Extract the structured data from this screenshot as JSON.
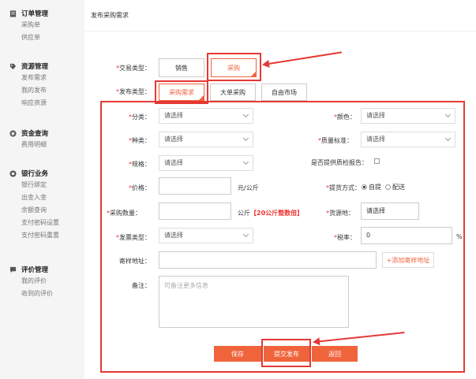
{
  "sidebar": {
    "groups": [
      {
        "title": "订单管理",
        "items": [
          "采购单",
          "供应单"
        ]
      },
      {
        "title": "资源管理",
        "items": [
          "发布需求",
          "我的发布",
          "响应资源"
        ]
      },
      {
        "title": "资金查询",
        "items": [
          "费用明细"
        ]
      },
      {
        "title": "银行业务",
        "items": [
          "银行绑定",
          "出金入金",
          "余额查询",
          "支付密码设置",
          "支付密码重置"
        ]
      },
      {
        "title": "评价管理",
        "items": [
          "我的评价",
          "收到的评价"
        ]
      }
    ]
  },
  "page": {
    "title": "发布采购需求"
  },
  "trade_type": {
    "label": "交易类型：",
    "options": [
      "销售",
      "采购"
    ],
    "selected": "采购"
  },
  "publish_type": {
    "label": "发布类型：",
    "options": [
      "采购需求",
      "大单采购",
      "自由市场"
    ],
    "selected": "采购需求"
  },
  "form": {
    "category": {
      "label": "分类：",
      "value": "请选择"
    },
    "color": {
      "label": "颜色：",
      "value": "请选择"
    },
    "kind": {
      "label": "种类：",
      "value": "请选择"
    },
    "quality": {
      "label": "质量标准：",
      "value": "请选择"
    },
    "spec": {
      "label": "规格：",
      "value": "请选择"
    },
    "inspection": {
      "label": "是否提供质检报告："
    },
    "price": {
      "label": "价格：",
      "value": "",
      "unit": "元/公斤"
    },
    "pickup": {
      "label": "提货方式：",
      "options": [
        "自提",
        "配送"
      ],
      "selected": "自提"
    },
    "quantity": {
      "label": "采购数量：",
      "value": "",
      "unit": "公斤",
      "hint": "【20公斤整数倍】"
    },
    "source": {
      "label": "货源地：",
      "value": "请选择"
    },
    "invoice": {
      "label": "发票类型：",
      "value": "请选择"
    },
    "tax": {
      "label": "税率：",
      "value": "0",
      "unit": "%"
    },
    "sample_addr": {
      "label": "寄样地址：",
      "value": "",
      "add_label": "+添加寄样地址"
    },
    "remark": {
      "label": "备注：",
      "placeholder": "可备注更多信息"
    }
  },
  "actions": {
    "save": "保存",
    "submit": "提交发布",
    "back": "返回"
  },
  "colors": {
    "accent": "#f0643c",
    "annotation": "#e53935"
  }
}
